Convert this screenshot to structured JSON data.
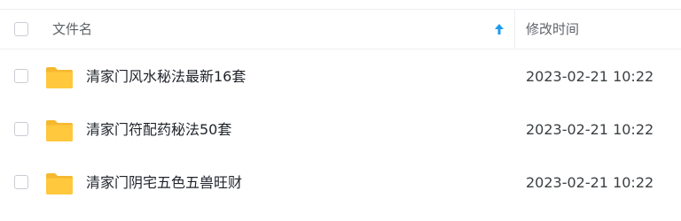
{
  "header": {
    "name_label": "文件名",
    "time_label": "修改时间",
    "sort_icon": "arrow-up-icon",
    "accent_color": "#1a9cf0"
  },
  "files": [
    {
      "icon": "folder-icon",
      "name": "清家门风水秘法最新16套",
      "modified": "2023-02-21 10:22"
    },
    {
      "icon": "folder-icon",
      "name": "清家门符配药秘法50套",
      "modified": "2023-02-21 10:22"
    },
    {
      "icon": "folder-icon",
      "name": "清家门阴宅五色五兽旺财",
      "modified": "2023-02-21 10:22"
    }
  ],
  "colors": {
    "folder": "#ffc83d",
    "folder_tab": "#f5b82e"
  }
}
